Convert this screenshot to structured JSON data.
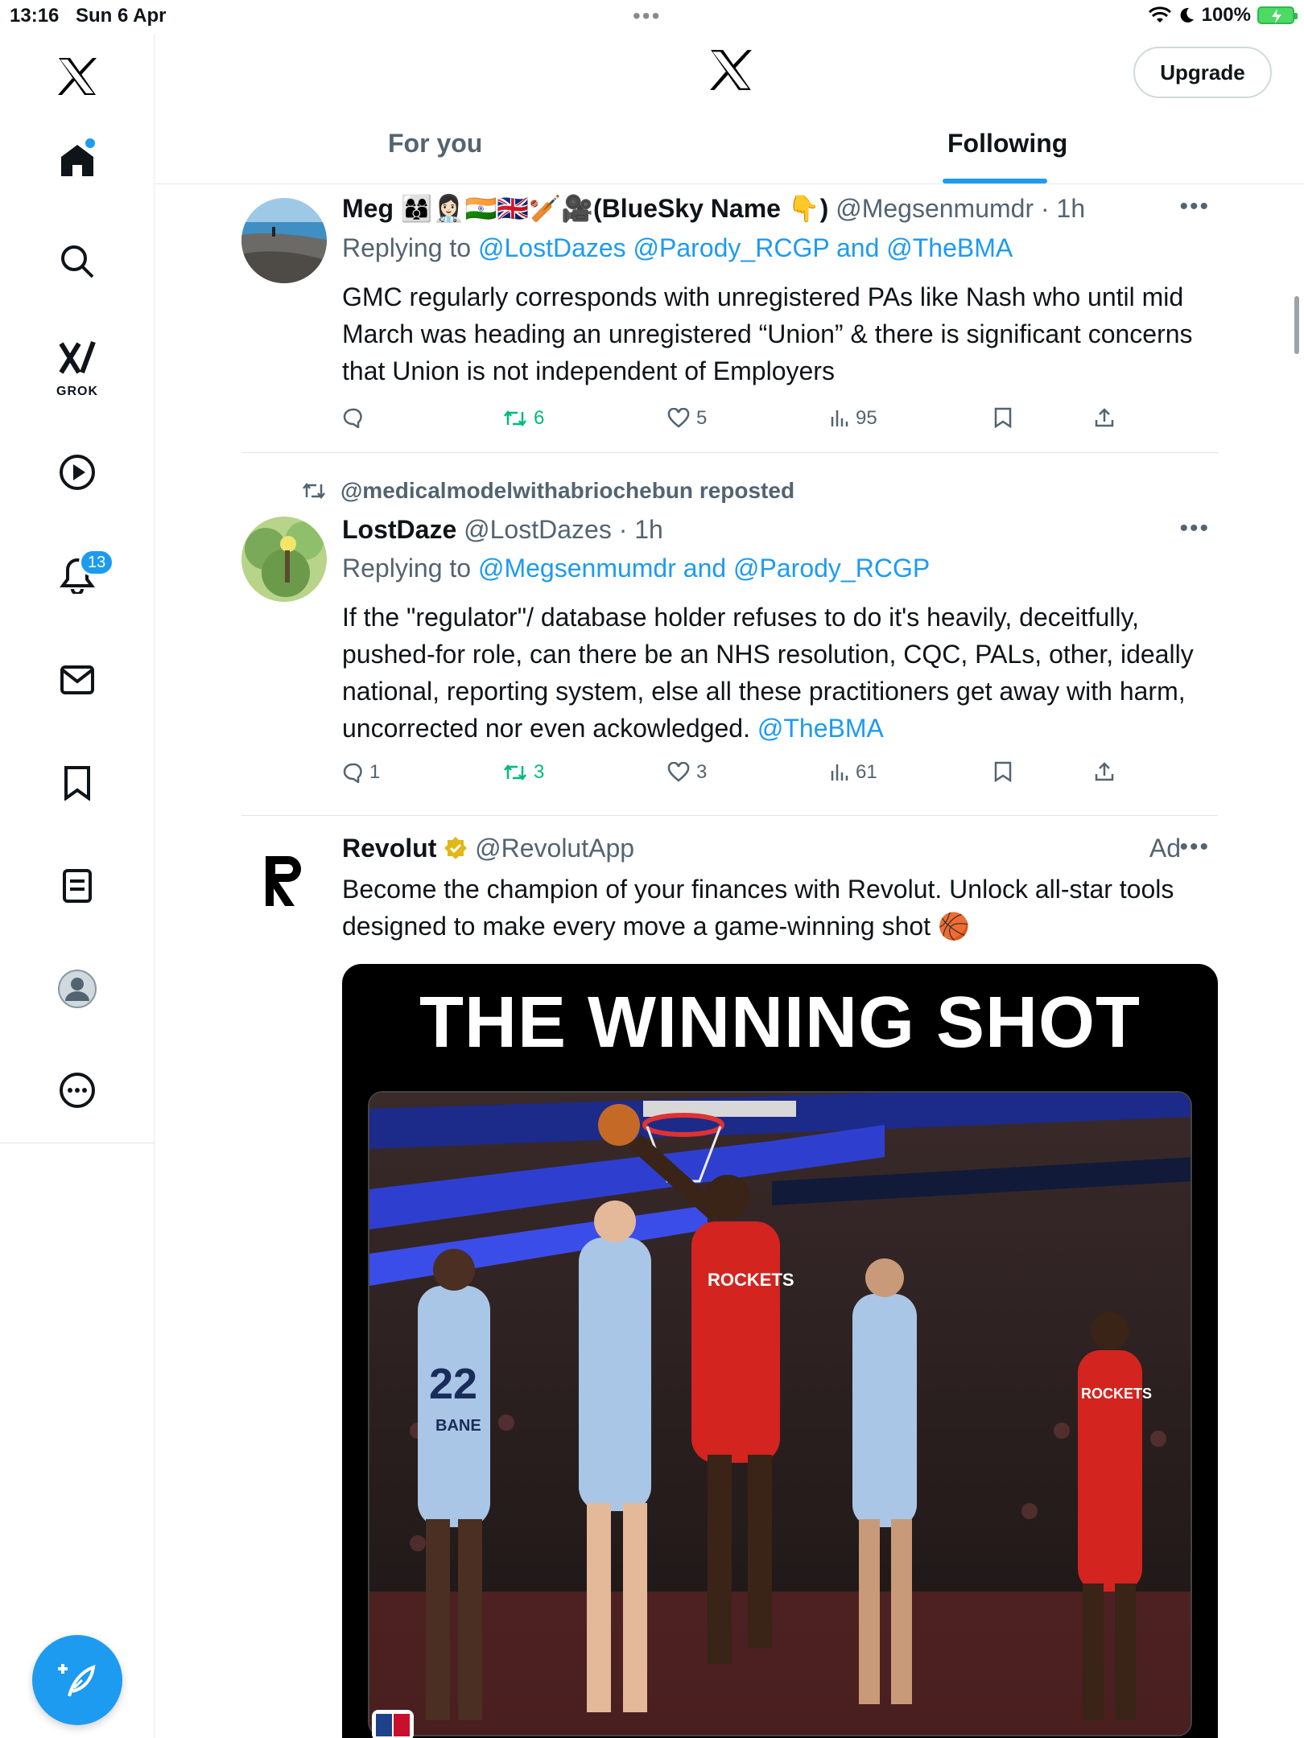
{
  "status_bar": {
    "time": "13:16",
    "date": "Sun 6 Apr",
    "battery_percent": "100%"
  },
  "sidebar": {
    "grok_label": "GROK",
    "notifications_badge": "13",
    "items": [
      "x-logo",
      "home",
      "search",
      "grok",
      "video",
      "notifications",
      "messages",
      "bookmarks",
      "lists",
      "profile",
      "more"
    ]
  },
  "header": {
    "upgrade_label": "Upgrade",
    "tabs": [
      {
        "label": "For you",
        "active": false
      },
      {
        "label": "Following",
        "active": true
      }
    ]
  },
  "tweets": [
    {
      "name": "Meg 👩‍👩‍👦👩🏻‍⚕️🇮🇳🇬🇧🏏🎥(BlueSky Name 👇)",
      "handle": "@Megsenmumdr",
      "time": "· 1h",
      "replying_prefix": "Replying to ",
      "replying_to": "@LostDazes @Parody_RCGP and @TheBMA",
      "body": "GMC regularly corresponds with unregistered PAs like Nash who until mid March was heading an unregistered “Union” & there is significant concerns that Union is not independent of Employers",
      "replies": "",
      "reposts": "6",
      "likes": "5",
      "views": "95"
    },
    {
      "repost_by": "@medicalmodelwithabriochebun reposted",
      "name": "LostDaze",
      "handle": "@LostDazes",
      "time": "· 1h",
      "replying_prefix": "Replying to ",
      "replying_to": "@Megsenmumdr and @Parody_RCGP",
      "body": "If the \"regulator\"/ database holder refuses to do it's heavily, deceitfully, pushed-for role, can there be an NHS resolution, CQC, PALs, other, ideally national, reporting system, else all these practitioners get away with harm, uncorrected nor even ackowledged.",
      "body_link": "@TheBMA",
      "replies": "1",
      "reposts": "3",
      "likes": "3",
      "views": "61"
    },
    {
      "name": "Revolut",
      "handle": "@RevolutApp",
      "ad_label": "Ad",
      "body": "Become the champion of your finances with Revolut. Unlock all-star tools designed to make every move a game-winning shot 🏀",
      "media_headline": "THE WINNING SHOT",
      "jersey_text_1": "22",
      "jersey_name_1": "BANE",
      "jersey_text_2": "ROCKETS",
      "jersey_text_3": "ROCKETS"
    }
  ],
  "colors": {
    "accent": "#1d9bf0",
    "repost_green": "#00ba7c",
    "secondary_text": "#536471"
  }
}
